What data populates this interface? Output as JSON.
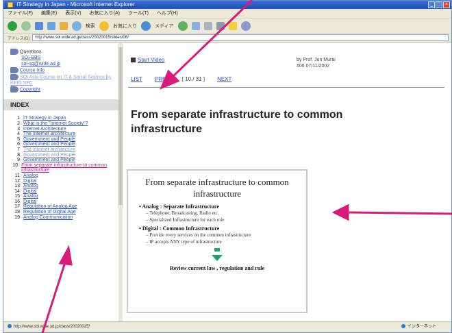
{
  "window": {
    "title": "IT Strategy in Japan - Microsoft Internet Explorer",
    "controls": [
      "_",
      "□",
      "×"
    ]
  },
  "menu": [
    "ファイル(F)",
    "編集(E)",
    "表示(V)",
    "お気に入り(A)",
    "ツール(T)",
    "ヘルプ(H)"
  ],
  "toolbar": {
    "search_label": "検索",
    "favorites_label": "お気に入り",
    "media_label": "メディア"
  },
  "address": {
    "label": "アドレス(D)",
    "url": "http://www.soi.wide.ad.jp/class/20020015/slides/06/"
  },
  "sidebar": {
    "questions_label": "Questions",
    "soi_bbs": "SOI-BBS",
    "email": "soi-sg@wide.ad.jp",
    "course_info": "Course Info",
    "soi_asia": "SOI Asia Course on IT & Social Science by KEIO SFC",
    "copyright": "Copyright",
    "index_title": "INDEX",
    "items": [
      {
        "num": "1",
        "text": "IT Strategy in Japan"
      },
      {
        "num": "2",
        "text": "What is the \"Internet Society\"?"
      },
      {
        "num": "3",
        "text": "Internet Architecture"
      },
      {
        "num": "4",
        "text": "The Internet architecture"
      },
      {
        "num": "5",
        "text": "Government and People"
      },
      {
        "num": "6",
        "text": "Government and People"
      },
      {
        "num": "7",
        "text": "The Internet architecture"
      },
      {
        "num": "8",
        "text": "Government and People"
      },
      {
        "num": "9",
        "text": "Government and People"
      },
      {
        "num": "10",
        "text": "From separate infrastructure to common infrastructure"
      },
      {
        "num": "11",
        "text": "Analog"
      },
      {
        "num": "12",
        "text": "Digital"
      },
      {
        "num": "13",
        "text": "Analog"
      },
      {
        "num": "14",
        "text": "Digital"
      },
      {
        "num": "15",
        "text": "Analog"
      },
      {
        "num": "16",
        "text": "Digital"
      },
      {
        "num": "17",
        "text": "Regulation of Analog Age"
      },
      {
        "num": "18",
        "text": "Regulation of Digital Age"
      },
      {
        "num": "19",
        "text": "Analog Communication"
      }
    ]
  },
  "main": {
    "start_video": "Start Video",
    "author": "by Prof. Jun Murai",
    "session": "#06 07/11/2002",
    "pager": {
      "list": "LIST",
      "prev": "PREV",
      "position": "[ 10 / 31 ]",
      "next": "NEXT"
    },
    "title": "From separate infrastructure to common infrastructure"
  },
  "slide": {
    "title": "From separate infrastructure to common infrastructure",
    "bullet1": "Analog : Separate Infrastructure",
    "bullet1_subs": [
      "Telephone, Broadcasting, Radio etc.",
      "Specialized Infrastructure for each role"
    ],
    "bullet2": "Digital : Common Infrastructure",
    "bullet2_subs": [
      "Provide every services on the common infrastructure",
      "IP accepts ANY type of infrastructure"
    ],
    "footer": "Review current law , regulation and rule"
  },
  "statusbar": {
    "url": "http://www.soi.wide.ad.jp/class/20020015/",
    "zone": "インターネット"
  },
  "colors": {
    "annotation_arrow": "#d81b78",
    "link": "#3050c0",
    "titlebar": "#1e4fb8",
    "slide_arrow": "#20a070"
  }
}
